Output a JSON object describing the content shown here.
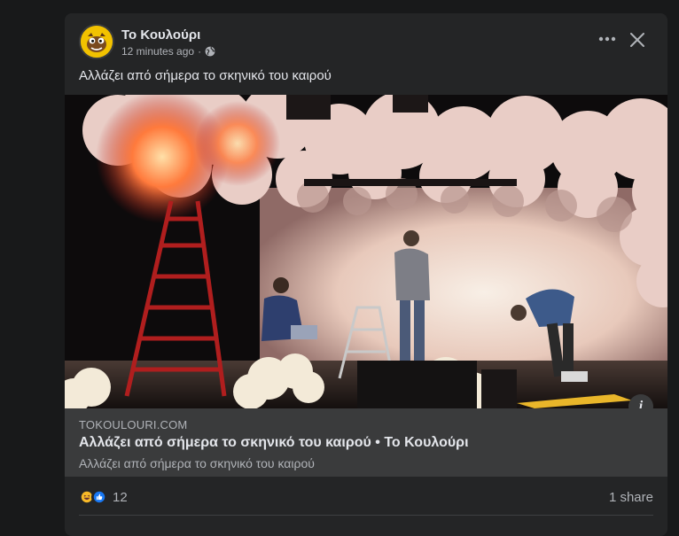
{
  "post": {
    "page_name": "Το Κουλούρι",
    "timestamp": "12 minutes ago",
    "separator": "·",
    "privacy_icon": "globe-icon",
    "message": "Αλλάζει από σήμερα το σκηνικό του καιρού"
  },
  "link_preview": {
    "domain": "TOKOULOURI.COM",
    "title": "Αλλάζει από σήμερα το σκηνικό του καιρού • Το Κουλούρι",
    "description": "Αλλάζει από σήμερα το σκηνικό του καιρού",
    "info_label": "i"
  },
  "footer": {
    "reaction_count": "12",
    "shares": "1 share",
    "reaction_icons": [
      "haha-icon",
      "like-icon"
    ]
  },
  "colors": {
    "background": "#18191a",
    "card": "#242526",
    "link_box": "#3a3b3c",
    "primary_text": "#e4e6eb",
    "secondary_text": "#b0b3b8",
    "like_blue": "#1877f2",
    "haha_yellow": "#f7b928"
  }
}
